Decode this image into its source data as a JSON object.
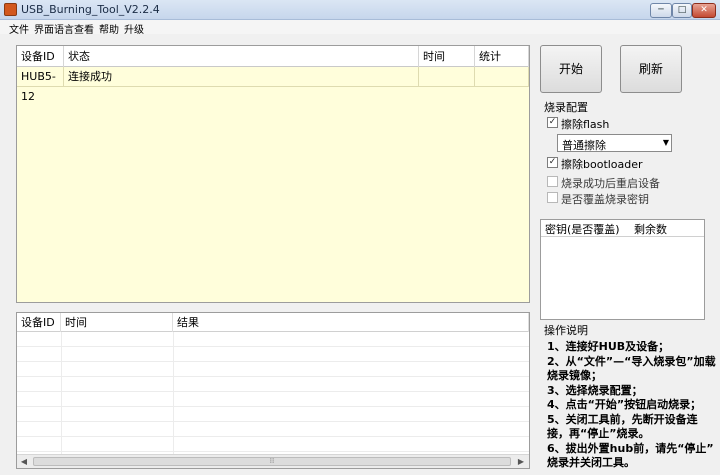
{
  "window": {
    "title": "USB_Burning_Tool_V2.2.4",
    "min": "─",
    "max": "□",
    "close": "✕"
  },
  "menu": [
    "文件",
    "界面语言",
    "查看",
    "帮助",
    "升级"
  ],
  "device_table": {
    "columns": [
      "设备ID",
      "状态",
      "时间",
      "统计"
    ],
    "rows": [
      {
        "id": "HUB5-12",
        "status": "连接成功",
        "time": "",
        "count": ""
      }
    ]
  },
  "result_table": {
    "columns": [
      "设备ID",
      "时间",
      "结果"
    ],
    "scroll_mark": "⁞⁞"
  },
  "buttons": {
    "start": "开始",
    "refresh": "刷新"
  },
  "burn_config": {
    "title": "烧录配置",
    "erase_flash": {
      "label": "擦除flash",
      "checked": true
    },
    "erase_mode": "普通擦除",
    "erase_bootloader": {
      "label": "擦除bootloader",
      "checked": true
    },
    "reboot_after": {
      "label": "烧录成功后重启设备",
      "checked": false
    },
    "overwrite_key": {
      "label": "是否覆盖烧录密钥",
      "checked": false
    }
  },
  "key_list": {
    "columns": [
      "密钥(是否覆盖)",
      "剩余数"
    ]
  },
  "instructions": {
    "title": "操作说明",
    "lines": [
      "1、连接好HUB及设备；",
      "2、从“文件”—“导入烧录包”加载",
      "烧录镜像；",
      "3、选择烧录配置；",
      "4、点击“开始”按钮启动烧录；",
      "5、关闭工具前，先断开设备连",
      "接，再“停止”烧录。",
      "6、拔出外置hub前，请先“停止”",
      "烧录并关闭工具。"
    ]
  }
}
